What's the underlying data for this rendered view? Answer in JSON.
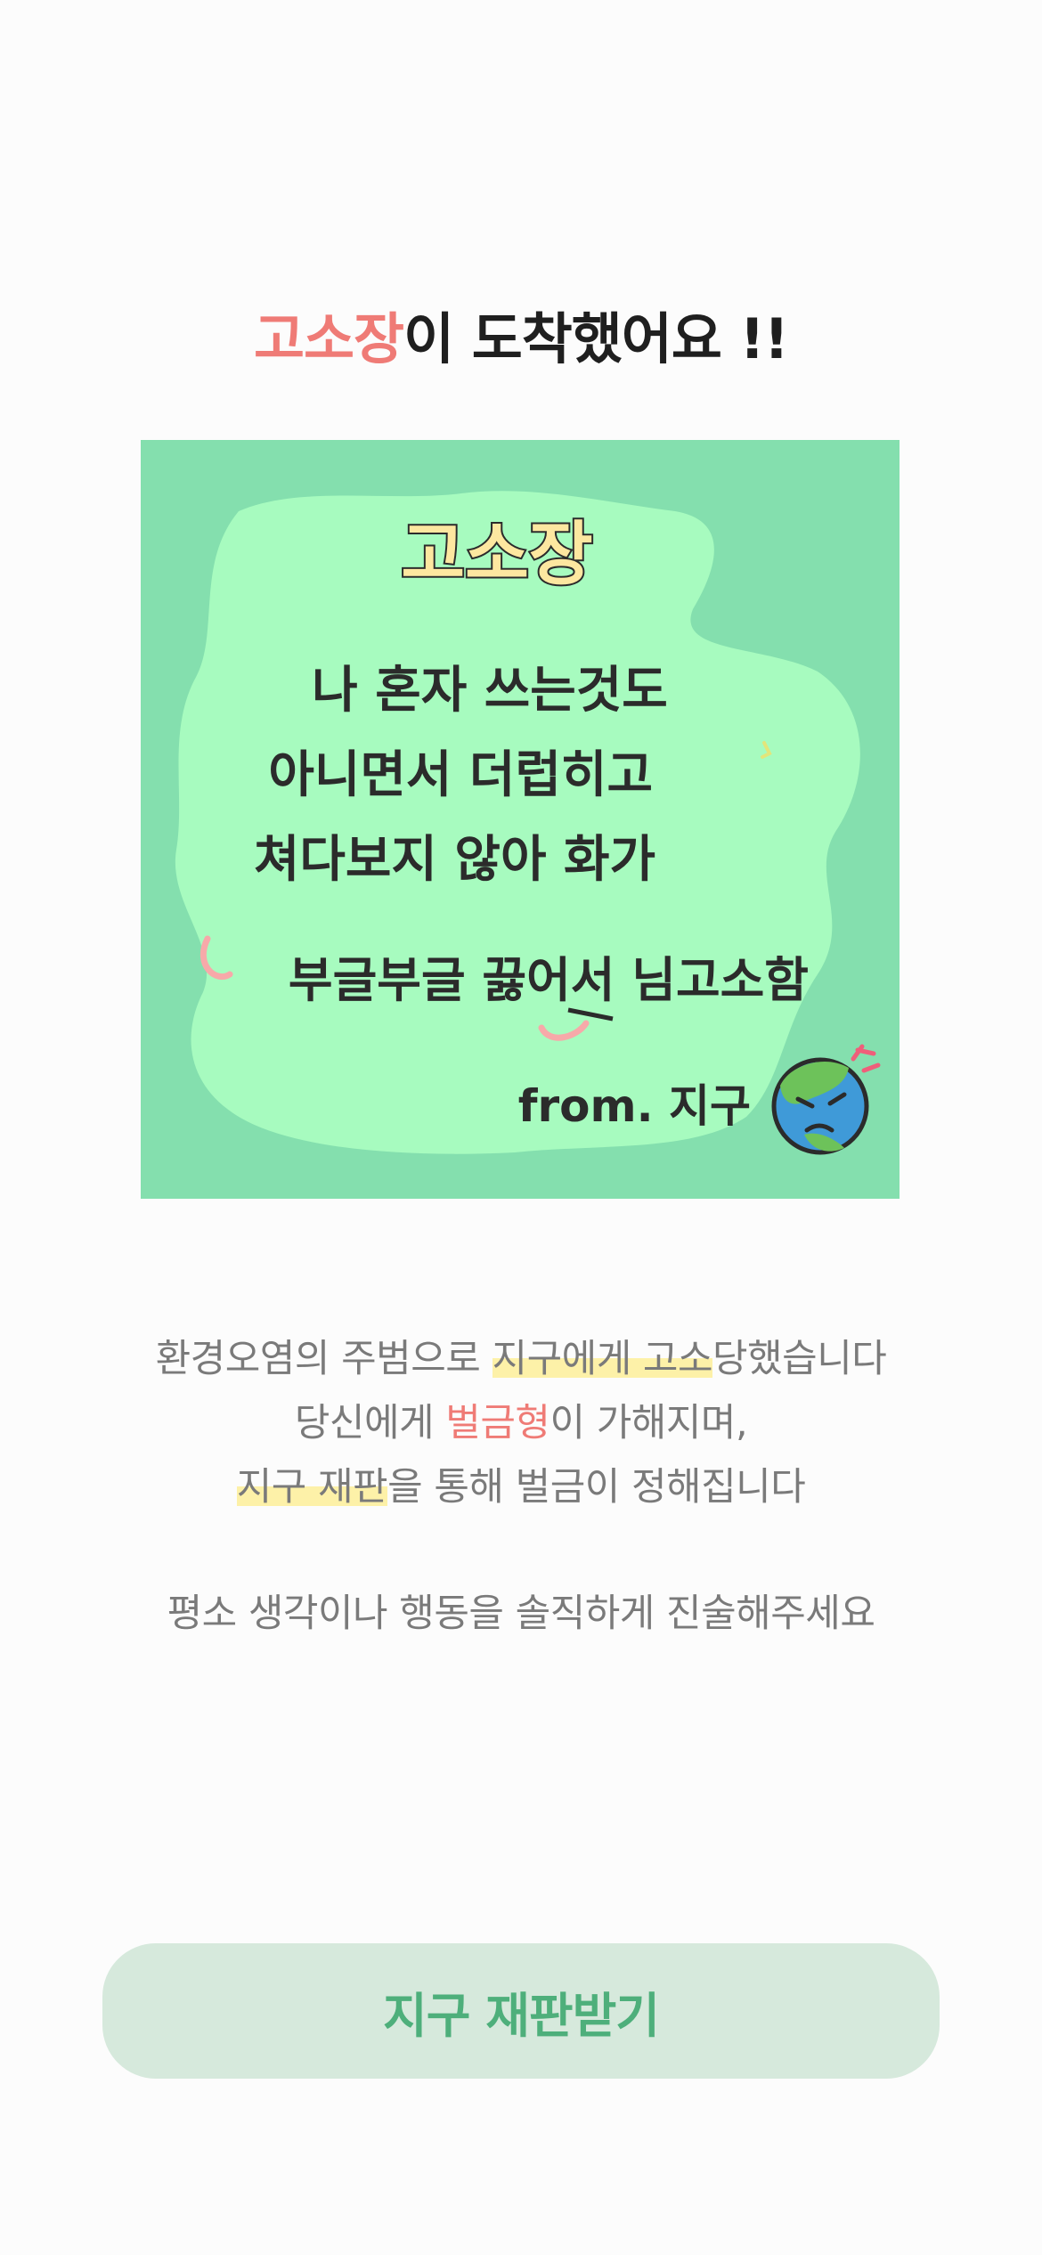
{
  "headline": {
    "accent": "고소장",
    "rest": "이 도착했어요 !!"
  },
  "card": {
    "title": "고소장",
    "lines": [
      "나 혼자 쓰는것도",
      "아니면서 더럽히고",
      "쳐다보지 않아 화가",
      "부글부글 끓어서 님고소함"
    ],
    "signature": "from. 지구",
    "colors": {
      "background": "#84dfae",
      "blob": "#a7fbbf",
      "title": "#fde7a0"
    },
    "icon": "angry-earth-icon"
  },
  "description": {
    "line1": {
      "before": "환경오염의 주범으로 ",
      "highlight": "지구에게 고소",
      "after": "당했습니다"
    },
    "line2": {
      "before": "당신에게 ",
      "red": "벌금형",
      "after": "이 가해지며,"
    },
    "line3": {
      "highlight": "지구 재판",
      "after": "을 통해 벌금이 정해집니다"
    },
    "line4": "평소 생각이나 행동을 솔직하게 진술해주세요"
  },
  "cta": {
    "label": "지구 재판받기",
    "color": "#4eaf7b",
    "background": "#d6e9dc"
  }
}
